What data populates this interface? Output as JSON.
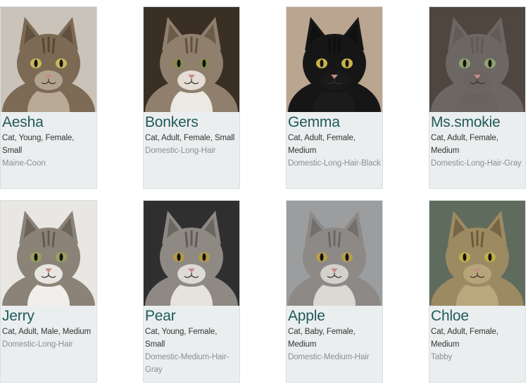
{
  "pets": [
    {
      "name": "Aesha",
      "meta": "Cat, Young, Female, Small",
      "breed": "Maine-Coon",
      "colors": {
        "bg": "#c9c3ba",
        "fur": "#7d6a55",
        "stripe": "#4a3b2c",
        "chest": "#b8aa96",
        "eye": "#c9b85a"
      }
    },
    {
      "name": "Bonkers",
      "meta": "Cat, Adult, Female, Small",
      "breed": "Domestic-Long-Hair",
      "colors": {
        "bg": "#3a2f25",
        "fur": "#8f7f6c",
        "stripe": "#4c3f31",
        "chest": "#ece8e2",
        "eye": "#8a8a54"
      }
    },
    {
      "name": "Gemma",
      "meta": "Cat, Adult, Female, Medium",
      "breed": "Domestic-Long-Hair-Black",
      "colors": {
        "bg": "#b9a590",
        "fur": "#171617",
        "stripe": "#0c0c0c",
        "chest": "#1c1b1c",
        "eye": "#c8b24a"
      }
    },
    {
      "name": "Ms.smokie",
      "meta": "Cat, Adult, Female, Medium",
      "breed": "Domestic-Long-Hair-Gray",
      "colors": {
        "bg": "#4f463f",
        "fur": "#6d6764",
        "stripe": "#5a5451",
        "chest": "#6a6461",
        "eye": "#8fa36a"
      }
    },
    {
      "name": "Jerry",
      "meta": "Cat, Adult, Male, Medium",
      "breed": "Domestic-Long-Hair",
      "colors": {
        "bg": "#e9e7e4",
        "fur": "#8b8378",
        "stripe": "#514a42",
        "chest": "#f1efec",
        "eye": "#9aa15a"
      }
    },
    {
      "name": "Pear",
      "meta": "Cat, Young, Female, Small",
      "breed": "Domestic-Medium-Hair-Gray",
      "colors": {
        "bg": "#2f2f30",
        "fur": "#8e8983",
        "stripe": "#4d4945",
        "chest": "#e6e3df",
        "eye": "#b49a47"
      }
    },
    {
      "name": "Apple",
      "meta": "Cat, Baby, Female, Medium",
      "breed": "Domestic-Medium-Hair",
      "colors": {
        "bg": "#9b9d9e",
        "fur": "#8c8986",
        "stripe": "#5d5a57",
        "chest": "#dcd9d5",
        "eye": "#b6a04a"
      }
    },
    {
      "name": "Chloe",
      "meta": "Cat, Adult, Female, Medium",
      "breed": "Tabby",
      "colors": {
        "bg": "#5f6b5d",
        "fur": "#9c8a62",
        "stripe": "#56482e",
        "chest": "#b9a77e",
        "eye": "#c1b04a"
      }
    }
  ]
}
